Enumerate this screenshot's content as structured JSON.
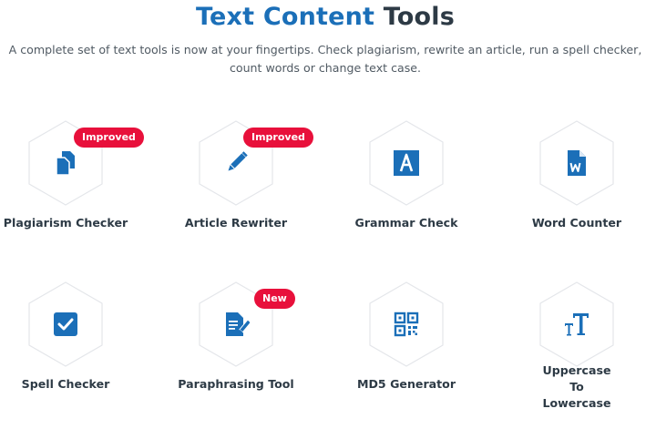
{
  "header": {
    "title_highlight": "Text Content",
    "title_rest": "Tools",
    "subtitle_line1": "A complete set of text tools is now at your fingertips. Check plagiarism, rewrite an article, run a spell checker,",
    "subtitle_line2": "count words or change text case."
  },
  "colors": {
    "accent": "#1b6fb8",
    "badge": "#e8103b",
    "text": "#2d3a45"
  },
  "tools": [
    {
      "label": "Plagiarism Checker",
      "icon": "copy-documents-icon",
      "badge": "Improved"
    },
    {
      "label": "Article Rewriter",
      "icon": "pencil-icon",
      "badge": "Improved"
    },
    {
      "label": "Grammar Check",
      "icon": "letter-a-icon",
      "badge": ""
    },
    {
      "label": "Word Counter",
      "icon": "word-document-icon",
      "badge": ""
    },
    {
      "label": "Spell Checker",
      "icon": "checkbox-icon",
      "badge": ""
    },
    {
      "label": "Paraphrasing Tool",
      "icon": "edit-document-icon",
      "badge": "New"
    },
    {
      "label": "MD5 Generator",
      "icon": "qr-code-icon",
      "badge": ""
    },
    {
      "label": "Uppercase To Lowercase",
      "icon": "text-case-icon",
      "badge": ""
    }
  ]
}
